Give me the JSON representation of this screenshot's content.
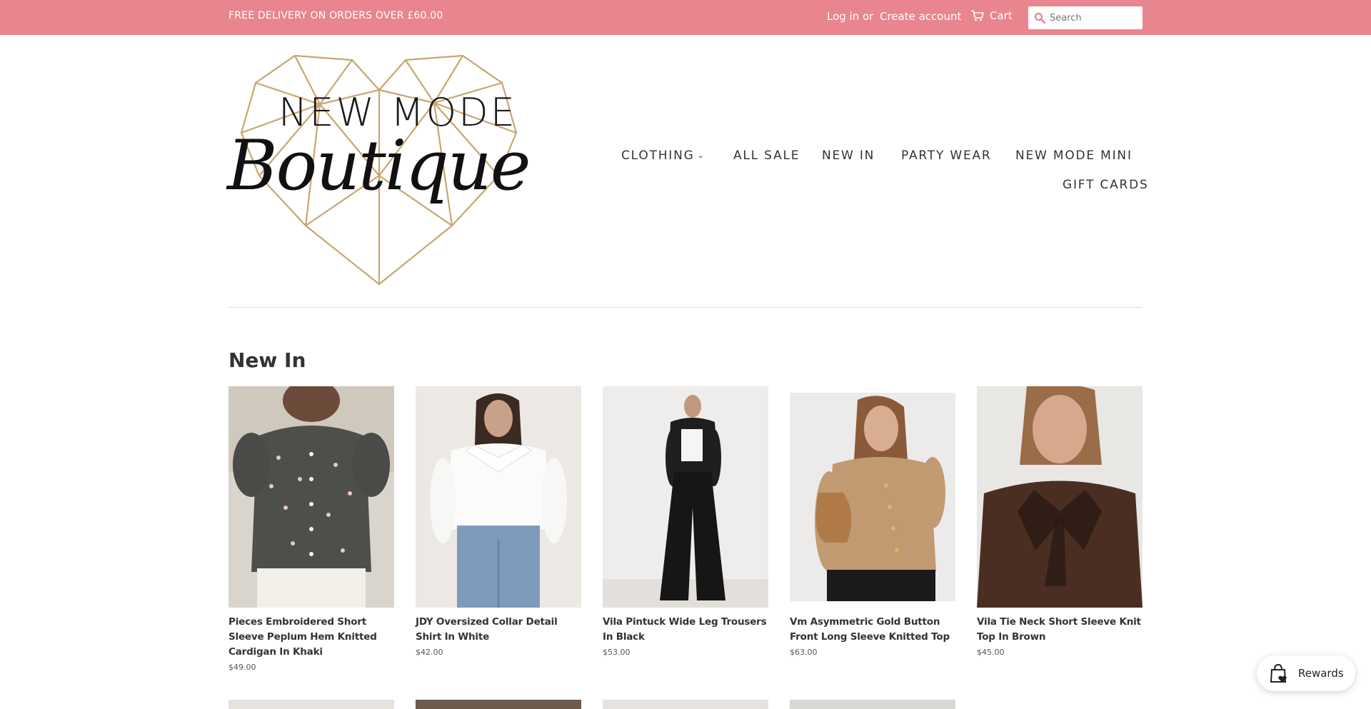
{
  "topbar": {
    "message": "FREE DELIVERY ON ORDERS OVER £60.00",
    "login": "Log in",
    "or": "or",
    "create_account": "Create account",
    "cart": "Cart",
    "search_placeholder": "Search"
  },
  "logo": {
    "line1": "NEW MODE",
    "line2": "Boutique"
  },
  "nav": {
    "clothing": "CLOTHING",
    "all_sale": "ALL SALE",
    "new_in": "NEW IN",
    "party_wear": "PARTY WEAR",
    "new_mode_mini": "NEW MODE MINI",
    "gift_cards": "GIFT CARDS"
  },
  "section": {
    "title": "New In"
  },
  "products": [
    {
      "title": "Pieces Embroidered Short Sleeve Peplum Hem Knitted Cardigan In Khaki",
      "price": "$49.00"
    },
    {
      "title": "JDY Oversized Collar Detail Shirt In White",
      "price": "$42.00"
    },
    {
      "title": "Vila Pintuck Wide Leg Trousers In Black",
      "price": "$53.00"
    },
    {
      "title": "Vm Asymmetric Gold Button Front Long Sleeve Knitted Top",
      "price": "$63.00"
    },
    {
      "title": "Vila Tie Neck Short Sleeve Knit Top In Brown",
      "price": "$45.00"
    }
  ],
  "rewards": {
    "label": "Rewards"
  },
  "colors": {
    "topbar": "#e8858e",
    "text": "#333333",
    "logo_gold": "#c9a570"
  }
}
